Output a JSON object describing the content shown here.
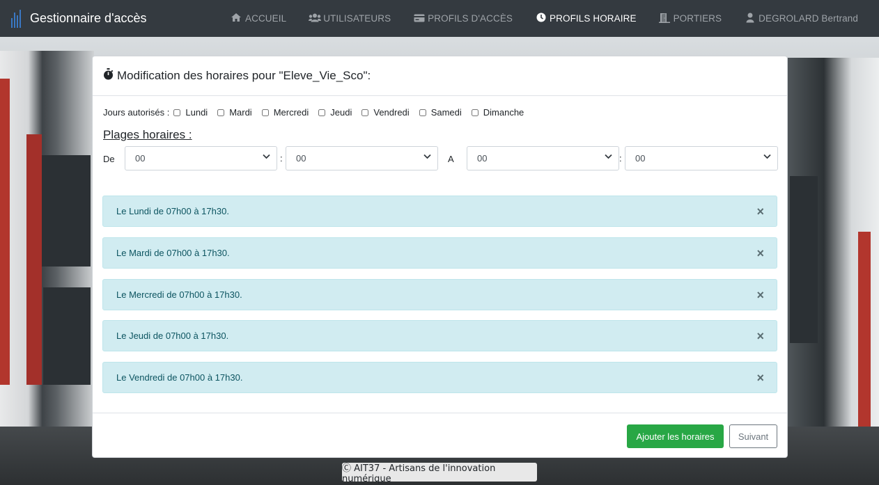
{
  "app": {
    "title": "Gestionnaire d'accès"
  },
  "nav": {
    "items": [
      {
        "label": "ACCUEIL",
        "icon": "home-icon",
        "active": false
      },
      {
        "label": "UTILISATEURS",
        "icon": "users-icon",
        "active": false
      },
      {
        "label": "PROFILS D'ACCÈS",
        "icon": "card-icon",
        "active": false
      },
      {
        "label": "PROFILS HORAIRE",
        "icon": "clock-icon",
        "active": true
      },
      {
        "label": "PORTIERS",
        "icon": "door-icon",
        "active": false
      },
      {
        "label": "DEGROLARD Bertrand",
        "icon": "user-icon",
        "active": false
      }
    ]
  },
  "modal": {
    "title": "Modification des horaires pour \"Eleve_Vie_Sco\":",
    "days_label": "Jours autorisés :",
    "days": [
      {
        "label": "Lundi",
        "checked": false
      },
      {
        "label": "Mardi",
        "checked": false
      },
      {
        "label": "Mercredi",
        "checked": false
      },
      {
        "label": "Jeudi",
        "checked": false
      },
      {
        "label": "Vendredi",
        "checked": false
      },
      {
        "label": "Samedi",
        "checked": false
      },
      {
        "label": "Dimanche",
        "checked": false
      }
    ],
    "plages_title": "Plages horaires :",
    "from_label": "De",
    "to_label": "A",
    "separator": ":",
    "from_hour": "00",
    "from_minute": "00",
    "to_hour": "00",
    "to_minute": "00",
    "schedules": [
      "Le Lundi de 07h00 à 17h30.",
      "Le Mardi de 07h00 à 17h30.",
      "Le Mercredi de 07h00 à 17h30.",
      "Le Jeudi de 07h00 à 17h30.",
      "Le Vendredi de 07h00 à 17h30."
    ],
    "close_glyph": "×",
    "add_button": "Ajouter les horaires",
    "next_button": "Suivant"
  },
  "footer": {
    "text": "Ⓒ AIT37 - Artisans de l'innovation numérique"
  },
  "colors": {
    "navbar": "#343a40",
    "success": "#28a745",
    "alert_bg": "#d1ecf1",
    "alert_text": "#0c5460"
  }
}
